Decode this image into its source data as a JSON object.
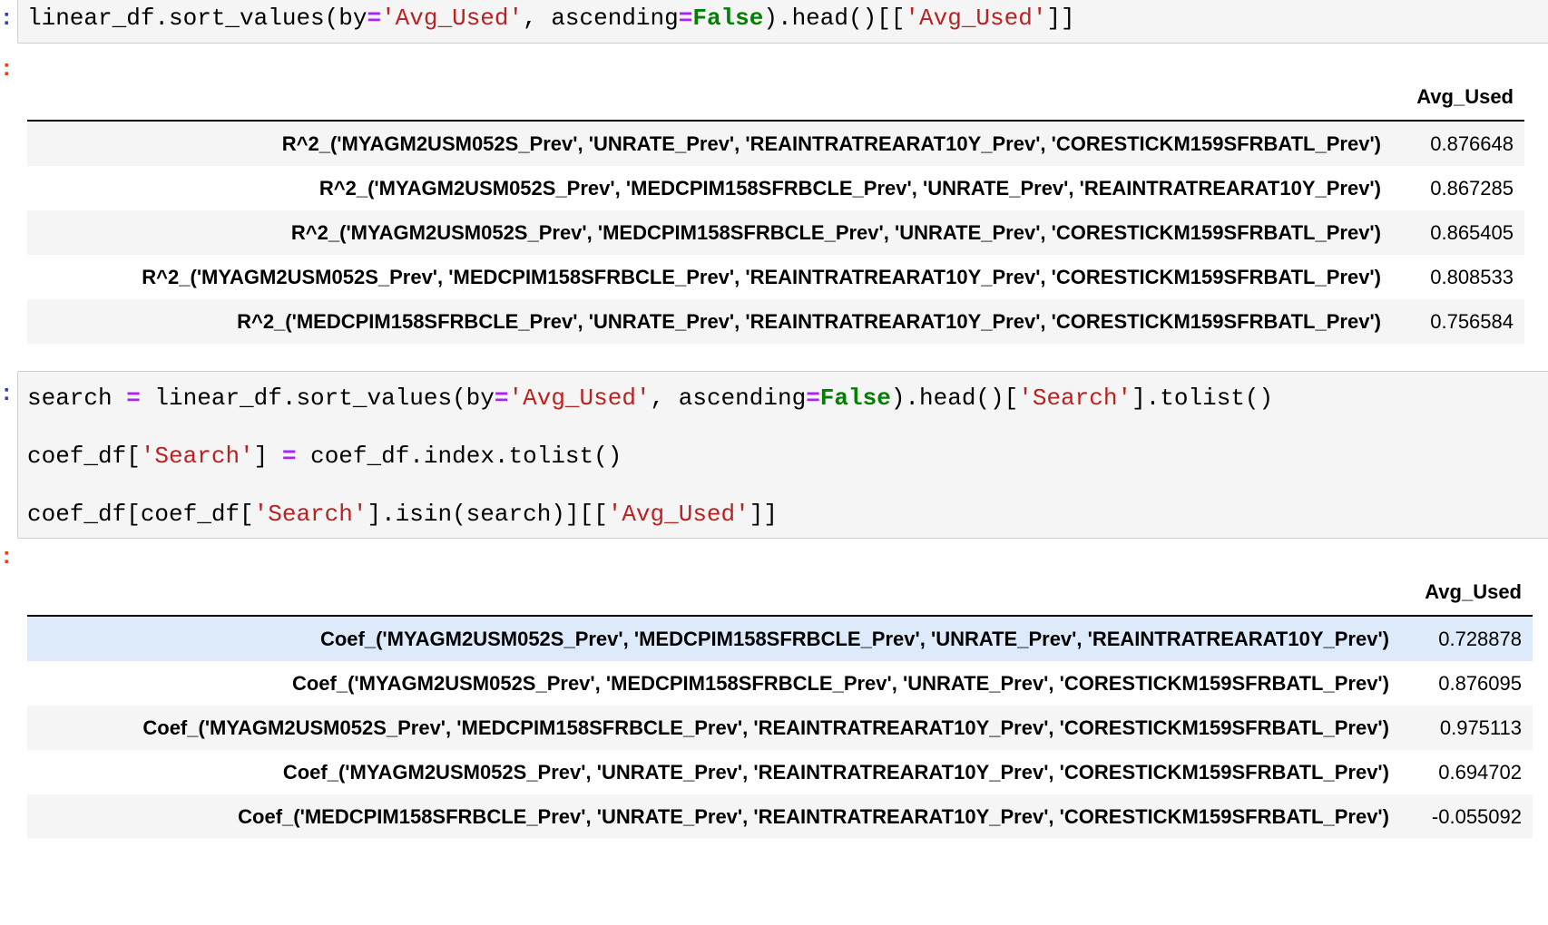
{
  "cell1": {
    "code": [
      [
        {
          "t": "linear_df.sort_values(by",
          "c": ""
        },
        {
          "t": "=",
          "c": "op"
        },
        {
          "t": "'Avg_Used'",
          "c": "str"
        },
        {
          "t": ", ascending",
          "c": ""
        },
        {
          "t": "=",
          "c": "op"
        },
        {
          "t": "False",
          "c": "const"
        },
        {
          "t": ").head()[[",
          "c": ""
        },
        {
          "t": "'Avg_Used'",
          "c": "str"
        },
        {
          "t": "]]",
          "c": ""
        }
      ]
    ]
  },
  "output1": {
    "column": "Avg_Used",
    "rows": [
      {
        "index": "R^2_('MYAGM2USM052S_Prev', 'UNRATE_Prev', 'REAINTRATREARAT10Y_Prev', 'CORESTICKM159SFRBATL_Prev')",
        "value": "0.876648"
      },
      {
        "index": "R^2_('MYAGM2USM052S_Prev', 'MEDCPIM158SFRBCLE_Prev', 'UNRATE_Prev', 'REAINTRATREARAT10Y_Prev')",
        "value": "0.867285"
      },
      {
        "index": "R^2_('MYAGM2USM052S_Prev', 'MEDCPIM158SFRBCLE_Prev', 'UNRATE_Prev', 'CORESTICKM159SFRBATL_Prev')",
        "value": "0.865405"
      },
      {
        "index": "R^2_('MYAGM2USM052S_Prev', 'MEDCPIM158SFRBCLE_Prev', 'REAINTRATREARAT10Y_Prev', 'CORESTICKM159SFRBATL_Prev')",
        "value": "0.808533"
      },
      {
        "index": "R^2_('MEDCPIM158SFRBCLE_Prev', 'UNRATE_Prev', 'REAINTRATREARAT10Y_Prev', 'CORESTICKM159SFRBATL_Prev')",
        "value": "0.756584"
      }
    ]
  },
  "cell2": {
    "code": [
      [
        {
          "t": "search ",
          "c": ""
        },
        {
          "t": "=",
          "c": "op"
        },
        {
          "t": " linear_df.sort_values(by",
          "c": ""
        },
        {
          "t": "=",
          "c": "op"
        },
        {
          "t": "'Avg_Used'",
          "c": "str"
        },
        {
          "t": ", ascending",
          "c": ""
        },
        {
          "t": "=",
          "c": "op"
        },
        {
          "t": "False",
          "c": "const"
        },
        {
          "t": ").head()[",
          "c": ""
        },
        {
          "t": "'Search'",
          "c": "str"
        },
        {
          "t": "].tolist()",
          "c": ""
        }
      ],
      [
        {
          "t": "coef_df[",
          "c": ""
        },
        {
          "t": "'Search'",
          "c": "str"
        },
        {
          "t": "] ",
          "c": ""
        },
        {
          "t": "=",
          "c": "op"
        },
        {
          "t": " coef_df.index.tolist()",
          "c": ""
        }
      ],
      [
        {
          "t": "coef_df[coef_df[",
          "c": ""
        },
        {
          "t": "'Search'",
          "c": "str"
        },
        {
          "t": "].isin(search)][[",
          "c": ""
        },
        {
          "t": "'Avg_Used'",
          "c": "str"
        },
        {
          "t": "]]",
          "c": ""
        }
      ]
    ]
  },
  "output2": {
    "column": "Avg_Used",
    "rows": [
      {
        "index": "Coef_('MYAGM2USM052S_Prev', 'MEDCPIM158SFRBCLE_Prev', 'UNRATE_Prev', 'REAINTRATREARAT10Y_Prev')",
        "value": "0.728878"
      },
      {
        "index": "Coef_('MYAGM2USM052S_Prev', 'MEDCPIM158SFRBCLE_Prev', 'UNRATE_Prev', 'CORESTICKM159SFRBATL_Prev')",
        "value": "0.876095"
      },
      {
        "index": "Coef_('MYAGM2USM052S_Prev', 'MEDCPIM158SFRBCLE_Prev', 'REAINTRATREARAT10Y_Prev', 'CORESTICKM159SFRBATL_Prev')",
        "value": "0.975113"
      },
      {
        "index": "Coef_('MYAGM2USM052S_Prev', 'UNRATE_Prev', 'REAINTRATREARAT10Y_Prev', 'CORESTICKM159SFRBATL_Prev')",
        "value": "0.694702"
      },
      {
        "index": "Coef_('MEDCPIM158SFRBCLE_Prev', 'UNRATE_Prev', 'REAINTRATREARAT10Y_Prev', 'CORESTICKM159SFRBATL_Prev')",
        "value": "-0.055092"
      }
    ]
  }
}
